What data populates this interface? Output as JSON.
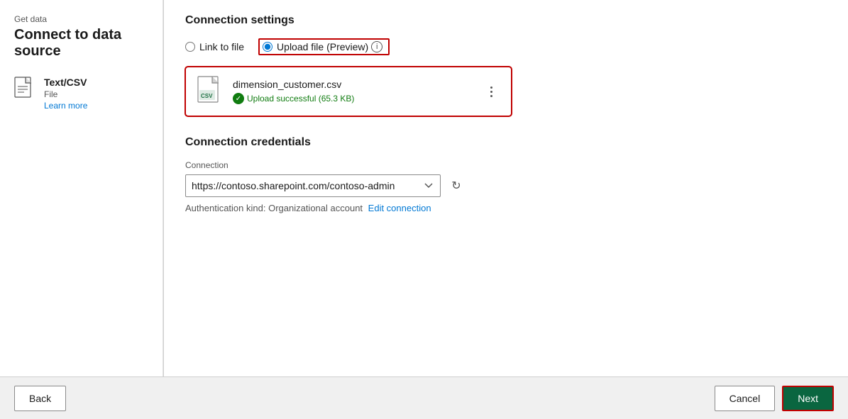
{
  "header": {
    "breadcrumb": "Get data",
    "title": "Connect to data source"
  },
  "sidebar": {
    "source_icon_label": "text-csv-icon",
    "source_name": "Text/CSV",
    "source_type": "File",
    "learn_more_label": "Learn more"
  },
  "connection_settings": {
    "section_title": "Connection settings",
    "radio_link": "Link to file",
    "radio_upload": "Upload file (Preview)",
    "file_name": "dimension_customer.csv",
    "upload_status": "Upload successful (65.3 KB)",
    "more_icon_label": "⋮"
  },
  "connection_credentials": {
    "section_title": "Connection credentials",
    "field_label": "Connection",
    "connection_value": "https://contoso.sharepoint.com/contoso-admin",
    "auth_label": "Authentication kind: Organizational account",
    "edit_link": "Edit connection"
  },
  "footer": {
    "back_label": "Back",
    "cancel_label": "Cancel",
    "next_label": "Next"
  }
}
